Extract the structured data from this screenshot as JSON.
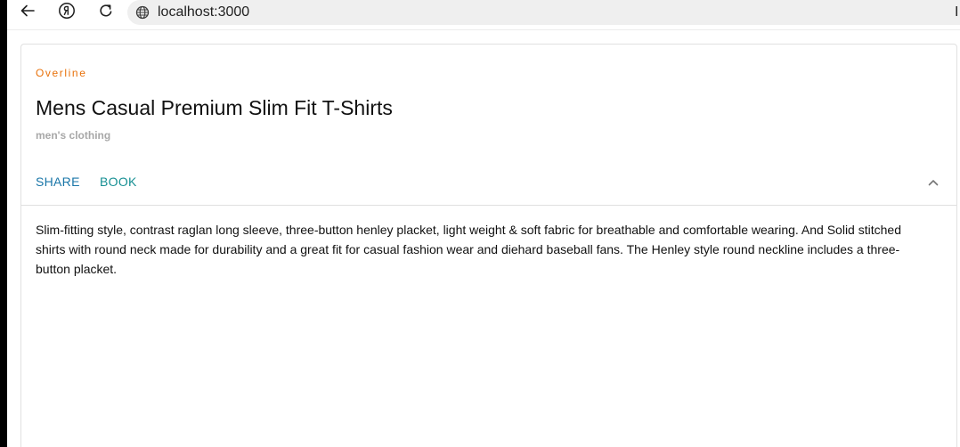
{
  "browser": {
    "address": "localhost:3000",
    "cursor_text": "I"
  },
  "card": {
    "overline": "Overline",
    "title": "Mens Casual Premium Slim Fit T-Shirts",
    "category": "men's clothing",
    "actions": {
      "share_label": "SHARE",
      "book_label": "BOOK"
    },
    "description": "Slim-fitting style, contrast raglan long sleeve, three-button henley placket, light weight & soft fabric for breathable and comfortable wearing. And Solid stitched shirts with round neck made for durability and a great fit for casual fashion wear and diehard baseball fans. The Henley style round neckline includes a three-button placket."
  },
  "colors": {
    "overline": "#e8710a",
    "share": "#1976a8",
    "book": "#168f93",
    "category": "#a8a8a8"
  },
  "icons": {
    "back": "back-arrow-icon",
    "yandex": "yandex-icon",
    "reload": "reload-icon",
    "site": "globe-icon",
    "expand": "chevron-up-icon"
  }
}
